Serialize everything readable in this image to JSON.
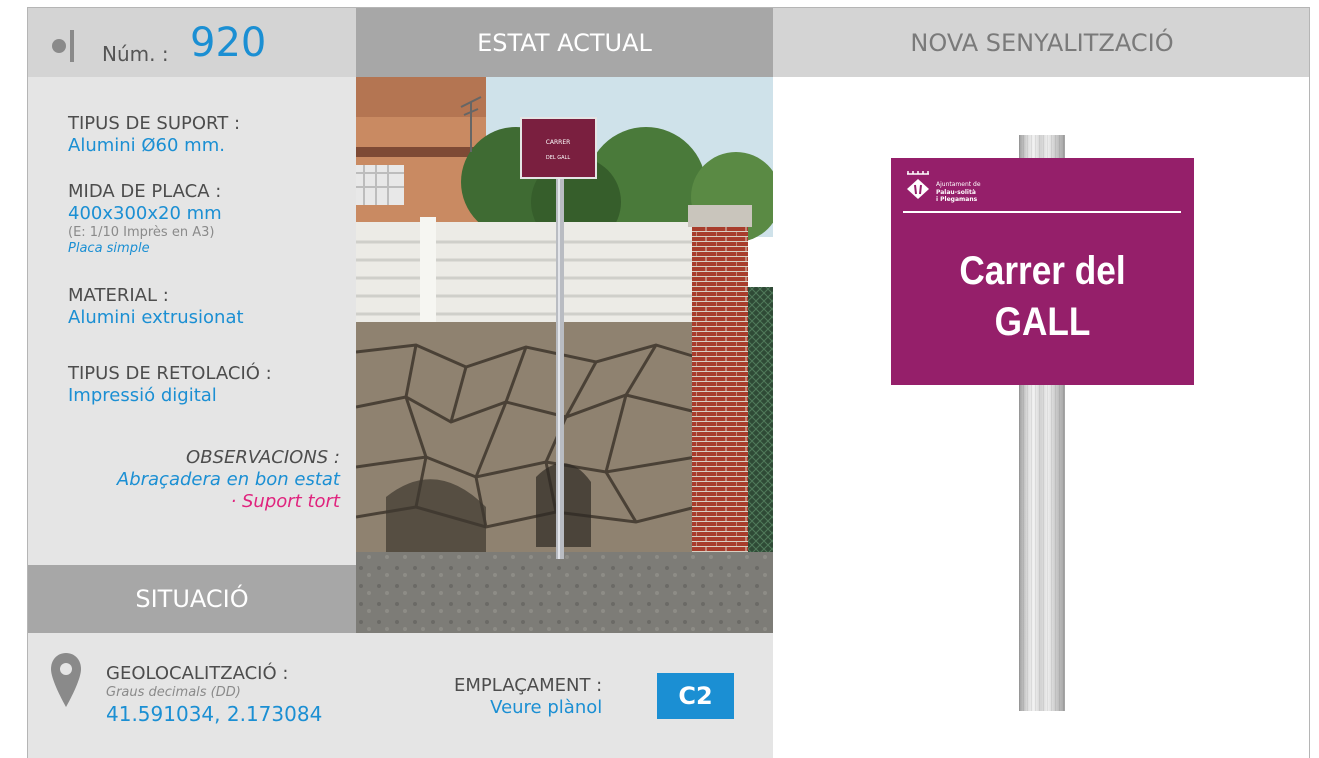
{
  "header": {
    "num_label": "Núm. :",
    "num_value": "920",
    "estat_title": "ESTAT ACTUAL",
    "nova_title": "NOVA SENYALITZACIÓ"
  },
  "details": {
    "tipus_suport_label": "TIPUS DE SUPORT :",
    "tipus_suport_value": "Alumini Ø60 mm.",
    "mida_placa_label": "MIDA DE PLACA :",
    "mida_placa_value": "400x300x20 mm",
    "mida_placa_scale": "(E: 1/10 Imprès en A3)",
    "mida_placa_type": "Placa simple",
    "material_label": "MATERIAL :",
    "material_value": "Alumini extrusionat",
    "retolacio_label": "TIPUS DE RETOLACIÓ :",
    "retolacio_value": "Impressió digital",
    "observacions_label": "OBSERVACIONS :",
    "observacions_ok": "Abraçadera en bon estat",
    "observacions_issue": "· Suport tort"
  },
  "situacio": {
    "title": "SITUACIÓ",
    "geo_label": "GEOLOCALITZACIÓ :",
    "geo_format": "Graus decimals (DD)",
    "geo_coords": "41.591034, 2.173084",
    "emplacament_label": "EMPLAÇAMENT :",
    "emplacament_link": "Veure plànol",
    "emplacament_code": "C2"
  },
  "photo": {
    "sign_line1": "CARRER",
    "sign_line2": "DEL GALL"
  },
  "new_sign": {
    "logo_line1": "Ajuntament de",
    "logo_line2": "Palau-solità",
    "logo_line3": "i Plegamans",
    "text_line1": "Carrer del",
    "text_line2": "GALL",
    "plate_color": "#951f6a"
  },
  "colors": {
    "accent_blue": "#1b8fd3",
    "alert_pink": "#e0247e",
    "header_dark": "#a7a7a7",
    "header_light": "#d4d4d4"
  }
}
